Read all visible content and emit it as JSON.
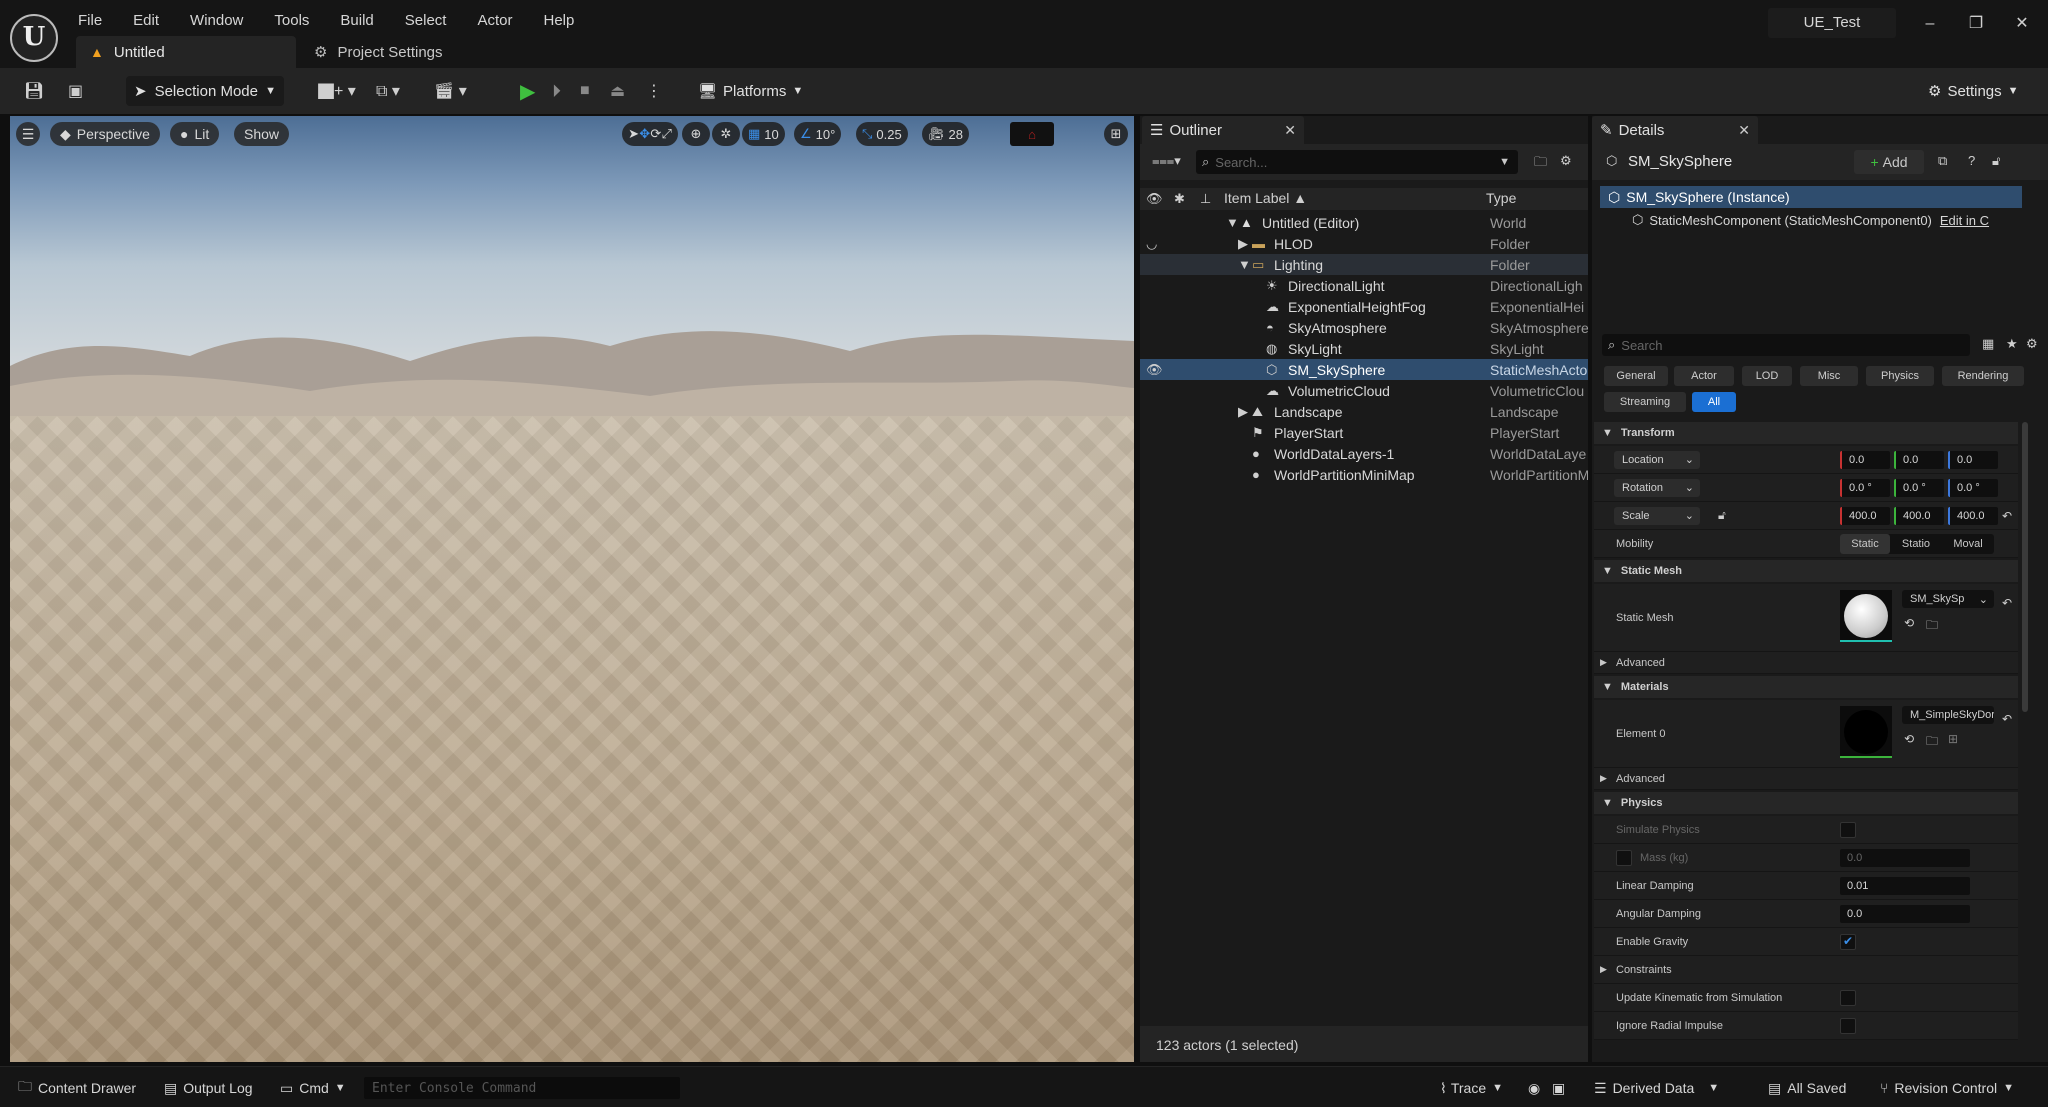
{
  "window": {
    "project_name": "UE_Test",
    "minimize": "–",
    "maximize": "❐",
    "close": "✕"
  },
  "menu": [
    "File",
    "Edit",
    "Window",
    "Tools",
    "Build",
    "Select",
    "Actor",
    "Help"
  ],
  "tabs": {
    "level": "Untitled",
    "project_settings": "Project Settings"
  },
  "toolbar": {
    "selection_mode": "Selection Mode",
    "platforms": "Platforms",
    "settings": "Settings"
  },
  "viewport": {
    "perspective": "Perspective",
    "lit": "Lit",
    "show": "Show",
    "grid_snap": "10",
    "rotation_snap": "10°",
    "scale_snap": "0.25",
    "camera_speed": "28"
  },
  "outliner": {
    "tab": "Outliner",
    "search_placeholder": "Search...",
    "col_label": "Item Label ▲",
    "col_type": "Type",
    "rows": [
      {
        "label": "Untitled (Editor)",
        "type": "World"
      },
      {
        "label": "HLOD",
        "type": "Folder"
      },
      {
        "label": "Lighting",
        "type": "Folder"
      },
      {
        "label": "DirectionalLight",
        "type": "DirectionalLigh"
      },
      {
        "label": "ExponentialHeightFog",
        "type": "ExponentialHei"
      },
      {
        "label": "SkyAtmosphere",
        "type": "SkyAtmosphere"
      },
      {
        "label": "SkyLight",
        "type": "SkyLight"
      },
      {
        "label": "SM_SkySphere",
        "type": "StaticMeshActo"
      },
      {
        "label": "VolumetricCloud",
        "type": "VolumetricClou"
      },
      {
        "label": "Landscape",
        "type": "Landscape"
      },
      {
        "label": "PlayerStart",
        "type": "PlayerStart"
      },
      {
        "label": "WorldDataLayers-1",
        "type": "WorldDataLaye"
      },
      {
        "label": "WorldPartitionMiniMap",
        "type": "WorldPartitionM"
      }
    ],
    "status": "123 actors (1 selected)"
  },
  "details": {
    "tab": "Details",
    "actor_name": "SM_SkySphere",
    "add_label": "Add",
    "instance_label": "SM_SkySphere (Instance)",
    "component_label": "StaticMeshComponent (StaticMeshComponent0)",
    "edit_in": "Edit in C",
    "search_placeholder": "Search",
    "filters": [
      "General",
      "Actor",
      "LOD",
      "Misc",
      "Physics",
      "Rendering",
      "Streaming",
      "All"
    ],
    "transform": {
      "section": "Transform",
      "location_label": "Location",
      "location": [
        "0.0",
        "0.0",
        "0.0"
      ],
      "rotation_label": "Rotation",
      "rotation": [
        "0.0 °",
        "0.0 °",
        "0.0 °"
      ],
      "scale_label": "Scale",
      "scale": [
        "400.0",
        "400.0",
        "400.0"
      ],
      "mobility_label": "Mobility",
      "mobility": [
        "Static",
        "Statio",
        "Moval"
      ]
    },
    "static_mesh": {
      "section": "Static Mesh",
      "label": "Static Mesh",
      "value": "SM_SkySp",
      "advanced": "Advanced"
    },
    "materials": {
      "section": "Materials",
      "element_label": "Element 0",
      "value": "M_SimpleSkyDor",
      "advanced": "Advanced"
    },
    "physics": {
      "section": "Physics",
      "simulate": "Simulate Physics",
      "mass_label": "Mass (kg)",
      "mass": "0.0",
      "linear_damping_label": "Linear Damping",
      "linear_damping": "0.01",
      "angular_damping_label": "Angular Damping",
      "angular_damping": "0.0",
      "enable_gravity": "Enable Gravity",
      "constraints": "Constraints",
      "update_kinematic": "Update Kinematic from Simulation",
      "ignore_radial": "Ignore Radial Impulse"
    }
  },
  "statusbar": {
    "content_drawer": "Content Drawer",
    "output_log": "Output Log",
    "cmd": "Cmd",
    "console_placeholder": "Enter Console Command",
    "trace": "Trace",
    "derived_data": "Derived Data",
    "all_saved": "All Saved",
    "revision_control": "Revision Control"
  }
}
